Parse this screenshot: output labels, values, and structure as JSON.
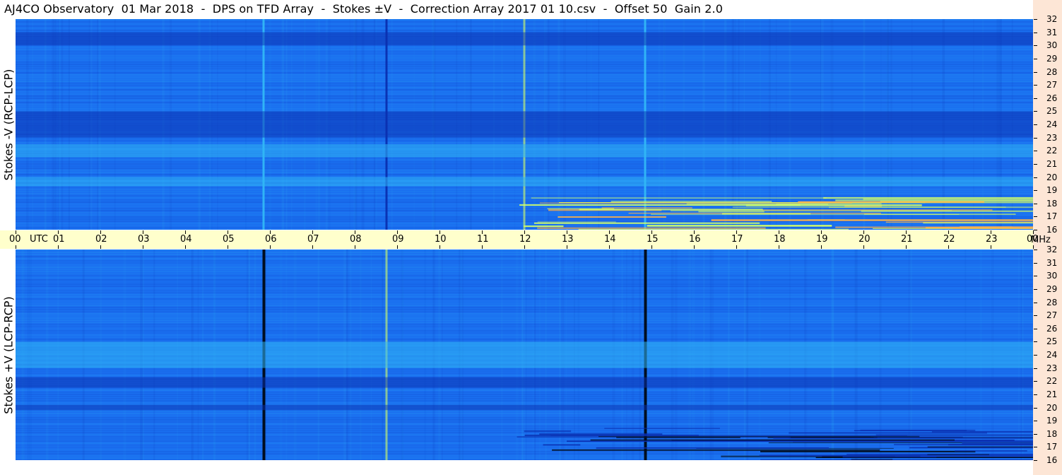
{
  "title": "AJ4CO Observatory  01 Mar 2018  -  DPS on TFD Array  -  Stokes ±V  -  Correction Array 2017 01 10.csv  -  Offset 50  Gain 2.0",
  "panels": {
    "top": {
      "label": "Stokes -V (RCP-LCP)"
    },
    "bottom": {
      "label": "Stokes +V (LCP-RCP)"
    }
  },
  "colors": {
    "background": "#ffffff",
    "time_axis": "#ffffcc",
    "right_bar": "#fde6d6",
    "spectrogram_base": "#1a6ff0",
    "spectrogram_dark": "#0a2fb0",
    "spectrogram_light": "#31b7f6",
    "spectrogram_hot": "#d4ff66"
  },
  "chart_data": [
    {
      "type": "heatmap",
      "title": "AJ4CO Observatory  01 Mar 2018  -  DPS on TFD Array  -  Stokes ±V  -  Correction Array 2017 01 10.csv  -  Offset 50  Gain 2.0",
      "ylabel": "Stokes -V (RCP-LCP)",
      "xlabel": "UTC",
      "xunit": "UTC",
      "yunit": "MHz",
      "xlim": [
        0,
        24
      ],
      "ylim": [
        16,
        32
      ],
      "x_ticks": [
        "00",
        "01",
        "02",
        "03",
        "04",
        "05",
        "06",
        "07",
        "08",
        "09",
        "10",
        "11",
        "12",
        "13",
        "14",
        "15",
        "16",
        "17",
        "18",
        "19",
        "20",
        "21",
        "22",
        "23",
        "00"
      ],
      "y_ticks": [
        32,
        31,
        30,
        29,
        28,
        27,
        26,
        25,
        24,
        23,
        22,
        21,
        20,
        19,
        18,
        17,
        16
      ],
      "features": [
        {
          "kind": "vertical-line",
          "utc": 5.85,
          "shade": "light"
        },
        {
          "kind": "vertical-line",
          "utc": 14.85,
          "shade": "light"
        },
        {
          "kind": "vertical-line",
          "utc": 12.0,
          "shade": "hot"
        },
        {
          "kind": "vertical-line",
          "utc": 8.75,
          "shade": "dark"
        },
        {
          "kind": "band",
          "mhz_low": 23,
          "mhz_high": 25,
          "shade": "dark"
        },
        {
          "kind": "band",
          "mhz_low": 21.5,
          "mhz_high": 22.5,
          "shade": "light"
        },
        {
          "kind": "band",
          "mhz_low": 19.3,
          "mhz_high": 20,
          "shade": "light"
        },
        {
          "kind": "band",
          "mhz_low": 30,
          "mhz_high": 31,
          "shade": "dark"
        },
        {
          "kind": "bursts",
          "utc_start": 11.8,
          "utc_end": 24,
          "mhz_low": 16,
          "mhz_high": 18.5,
          "shade": "hot"
        }
      ]
    },
    {
      "type": "heatmap",
      "ylabel": "Stokes +V (LCP-RCP)",
      "xlabel": "UTC",
      "xunit": "UTC",
      "yunit": "MHz",
      "xlim": [
        0,
        24
      ],
      "ylim": [
        16,
        32
      ],
      "x_ticks": [
        "00",
        "01",
        "02",
        "03",
        "04",
        "05",
        "06",
        "07",
        "08",
        "09",
        "10",
        "11",
        "12",
        "13",
        "14",
        "15",
        "16",
        "17",
        "18",
        "19",
        "20",
        "21",
        "22",
        "23",
        "00"
      ],
      "y_ticks": [
        32,
        31,
        30,
        29,
        28,
        27,
        26,
        25,
        24,
        23,
        22,
        21,
        20,
        19,
        18,
        17,
        16
      ],
      "features": [
        {
          "kind": "vertical-line",
          "utc": 5.85,
          "shade": "black"
        },
        {
          "kind": "vertical-line",
          "utc": 14.85,
          "shade": "black"
        },
        {
          "kind": "vertical-line",
          "utc": 8.75,
          "shade": "hot"
        },
        {
          "kind": "band",
          "mhz_low": 23,
          "mhz_high": 25,
          "shade": "light"
        },
        {
          "kind": "band",
          "mhz_low": 21.5,
          "mhz_high": 22.3,
          "shade": "dark"
        },
        {
          "kind": "band",
          "mhz_low": 19.8,
          "mhz_high": 20.2,
          "shade": "dark"
        },
        {
          "kind": "bursts",
          "utc_start": 11.8,
          "utc_end": 24,
          "mhz_low": 16,
          "mhz_high": 18.5,
          "shade": "dark"
        }
      ]
    }
  ],
  "time_axis": {
    "hours": [
      "00",
      "01",
      "02",
      "03",
      "04",
      "05",
      "06",
      "07",
      "08",
      "09",
      "10",
      "11",
      "12",
      "13",
      "14",
      "15",
      "16",
      "17",
      "18",
      "19",
      "20",
      "21",
      "22",
      "23",
      "00"
    ],
    "utc_label": "UTC",
    "mhz_label": "MHz"
  },
  "freq_labels": [
    "32",
    "31",
    "30",
    "29",
    "28",
    "27",
    "26",
    "25",
    "24",
    "23",
    "22",
    "21",
    "20",
    "19",
    "18",
    "17",
    "16"
  ]
}
